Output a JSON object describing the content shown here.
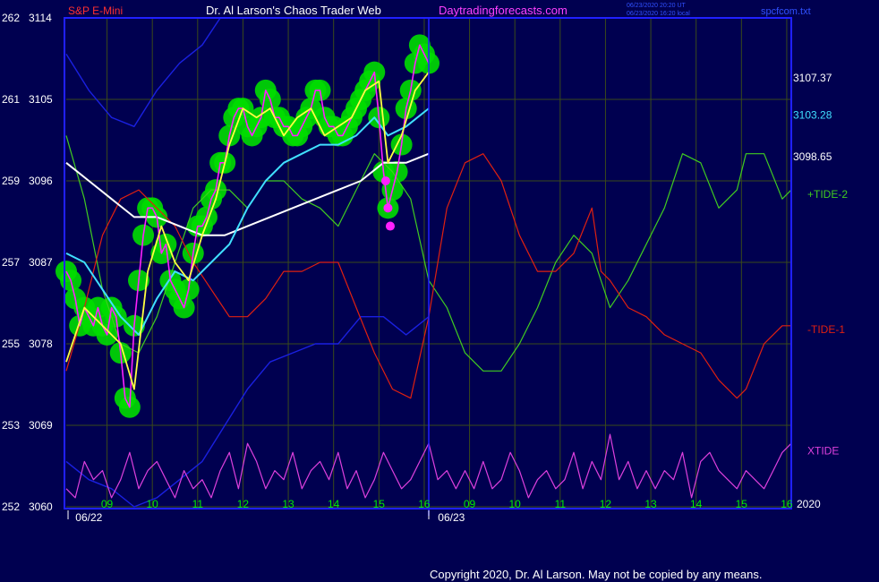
{
  "header": {
    "instrument": "S&P E-Mini",
    "title": "Dr. Al Larson's Chaos Trader Web",
    "site": "Daytradingforecasts.com",
    "time_line1": "06/23/2020 20:20 UT",
    "time_line2": "06/23/2020 16:20 local",
    "file": "spcfcom.txt"
  },
  "footer": {
    "copyright": "Copyright 2020, Dr. Al Larson. May not be copied by any means.",
    "year": "2020"
  },
  "colors": {
    "background": "#000050",
    "frame": "#2020ff",
    "grid": "#3a4a1a",
    "price": "#ff20ff",
    "glow": "#00dd00",
    "ema_fast": "#ffff40",
    "ema_mid": "#40e0ff",
    "ema_slow": "#ffffff",
    "band": "#1a20e0",
    "tide2": "#40cc20",
    "tide1": "#e02010",
    "xtide": "#dd40dd",
    "instrument_text": "#ff3030",
    "title_text": "#ffffff",
    "site_text": "#ff40ff",
    "axis_text": "#ffffff",
    "hour_text": "#00ee00"
  },
  "chart_data": {
    "type": "line",
    "title": "S&P E-Mini",
    "ylim": [
      3060,
      3114
    ],
    "y_ticks": [
      {
        "left": "262",
        "price": "3114",
        "value": 3114
      },
      {
        "left": "261",
        "price": "3105",
        "value": 3105
      },
      {
        "left": "259",
        "price": "3096",
        "value": 3096
      },
      {
        "left": "257",
        "price": "3087",
        "value": 3087
      },
      {
        "left": "255",
        "price": "3078",
        "value": 3078
      },
      {
        "left": "253",
        "price": "3069",
        "value": 3069
      },
      {
        "left": "252",
        "price": "3060",
        "value": 3060
      }
    ],
    "x_ticks": [
      {
        "label": "09",
        "idx": 0.9
      },
      {
        "label": "10",
        "idx": 1.9
      },
      {
        "label": "11",
        "idx": 2.9
      },
      {
        "label": "12",
        "idx": 3.9
      },
      {
        "label": "13",
        "idx": 4.9
      },
      {
        "label": "14",
        "idx": 5.9
      },
      {
        "label": "15",
        "idx": 6.9
      },
      {
        "label": "16",
        "idx": 7.9
      },
      {
        "label": "09",
        "idx": 8.9
      },
      {
        "label": "10",
        "idx": 9.9
      },
      {
        "label": "11",
        "idx": 10.9
      },
      {
        "label": "12",
        "idx": 11.9
      },
      {
        "label": "13",
        "idx": 12.9
      },
      {
        "label": "14",
        "idx": 13.9
      },
      {
        "label": "15",
        "idx": 14.9
      },
      {
        "label": "16",
        "idx": 15.9
      }
    ],
    "x_max": 16,
    "date_labels": [
      {
        "label": "06/22",
        "idx": 0.5
      },
      {
        "label": "06/23",
        "idx": 8.5
      }
    ],
    "now_idx": 8.0,
    "right_labels": [
      {
        "label": "3107.37",
        "value": 3107.37,
        "color": "#ffffff"
      },
      {
        "label": "3103.28",
        "value": 3103.28,
        "color": "#40e0ff"
      },
      {
        "label": "3098.65",
        "value": 3098.65,
        "color": "#ffffff"
      }
    ],
    "tide_labels": [
      {
        "label": "+TIDE-2",
        "value": 3094.5,
        "color": "#40cc20"
      },
      {
        "label": "-TIDE-1",
        "value": 3079.6,
        "color": "#e02010"
      },
      {
        "label": "XTIDE",
        "value": 3066.2,
        "color": "#dd40dd"
      }
    ],
    "series": [
      {
        "key": "price",
        "x": [
          0,
          0.1,
          0.2,
          0.3,
          0.4,
          0.5,
          0.6,
          0.7,
          0.8,
          0.9,
          1.0,
          1.1,
          1.2,
          1.3,
          1.4,
          1.5,
          1.6,
          1.7,
          1.8,
          1.9,
          2.0,
          2.1,
          2.2,
          2.3,
          2.4,
          2.5,
          2.6,
          2.7,
          2.8,
          2.9,
          3.0,
          3.1,
          3.2,
          3.3,
          3.4,
          3.5,
          3.6,
          3.7,
          3.8,
          3.9,
          4.0,
          4.1,
          4.2,
          4.3,
          4.4,
          4.5,
          4.6,
          4.7,
          4.8,
          4.9,
          5.0,
          5.1,
          5.2,
          5.3,
          5.4,
          5.5,
          5.6,
          5.7,
          5.8,
          5.9,
          6.0,
          6.1,
          6.2,
          6.3,
          6.4,
          6.5,
          6.6,
          6.7,
          6.8,
          6.9,
          7.0,
          7.1,
          7.2,
          7.3,
          7.4,
          7.5,
          7.6,
          7.7,
          7.8,
          7.9,
          8.0
        ],
        "y": [
          3086,
          3085,
          3083,
          3080,
          3082,
          3081,
          3080,
          3082,
          3080,
          3079,
          3082,
          3081,
          3077,
          3072,
          3071,
          3080,
          3085,
          3090,
          3093,
          3093,
          3092,
          3088,
          3089,
          3085,
          3084,
          3083,
          3082,
          3084,
          3088,
          3091,
          3091,
          3092,
          3094,
          3095,
          3098,
          3098,
          3101,
          3103,
          3104,
          3104,
          3102,
          3101,
          3102,
          3103,
          3106,
          3105,
          3103,
          3103,
          3102,
          3102,
          3101,
          3101,
          3102,
          3103,
          3104,
          3106,
          3106,
          3103,
          3102,
          3102,
          3101,
          3101,
          3102,
          3103,
          3104,
          3105,
          3106,
          3107,
          3108,
          3103,
          3097,
          3093,
          3095,
          3097,
          3100,
          3104,
          3106,
          3109,
          3111,
          3110,
          3109
        ]
      },
      {
        "key": "ema_fast",
        "x": [
          0,
          0.4,
          0.8,
          1.2,
          1.5,
          1.8,
          2.1,
          2.4,
          2.7,
          3.0,
          3.3,
          3.6,
          3.9,
          4.2,
          4.5,
          4.8,
          5.1,
          5.4,
          5.7,
          6.0,
          6.3,
          6.6,
          6.9,
          7.1,
          7.4,
          7.7,
          8.0
        ],
        "y": [
          3076,
          3082,
          3080,
          3078,
          3073,
          3086,
          3091,
          3087,
          3085,
          3090,
          3094,
          3100,
          3104,
          3103,
          3104,
          3101,
          3103,
          3104,
          3101,
          3102,
          3103,
          3106,
          3107,
          3098,
          3101,
          3106,
          3108
        ]
      },
      {
        "key": "ema_mid",
        "x": [
          0,
          0.4,
          0.8,
          1.2,
          1.6,
          2.0,
          2.4,
          2.8,
          3.2,
          3.6,
          4.0,
          4.4,
          4.8,
          5.2,
          5.6,
          6.0,
          6.4,
          6.8,
          7.1,
          7.5,
          8.0
        ],
        "y": [
          3088,
          3087,
          3084,
          3081,
          3079,
          3083,
          3086,
          3085,
          3087,
          3089,
          3093,
          3096,
          3098,
          3099,
          3100,
          3100,
          3101,
          3103,
          3101,
          3102,
          3104
        ]
      },
      {
        "key": "ema_slow",
        "x": [
          0,
          0.5,
          1.0,
          1.5,
          2.0,
          2.5,
          3.0,
          3.5,
          4.0,
          4.5,
          5.0,
          5.5,
          6.0,
          6.5,
          7.0,
          7.5,
          8.0
        ],
        "y": [
          3098,
          3096,
          3094,
          3092,
          3092,
          3091,
          3090,
          3090,
          3091,
          3092,
          3093,
          3094,
          3095,
          3096,
          3098,
          3098,
          3099
        ]
      },
      {
        "key": "band_upper",
        "x": [
          0,
          0.5,
          1.0,
          1.5,
          2.0,
          2.5,
          3.0,
          3.4
        ],
        "y": [
          3110,
          3106,
          3103,
          3102,
          3106,
          3109,
          3111,
          3114
        ]
      },
      {
        "key": "band_lower",
        "x": [
          0,
          0.5,
          1.0,
          1.5,
          2.0,
          2.5,
          3.0,
          3.5,
          4.0,
          4.5,
          5.0,
          5.5,
          6.0,
          6.5,
          7.0,
          7.5,
          8.0
        ],
        "y": [
          3065,
          3063,
          3062,
          3060,
          3061,
          3063,
          3065,
          3069,
          3073,
          3076,
          3077,
          3078,
          3078,
          3081,
          3081,
          3079,
          3081
        ]
      },
      {
        "key": "tide2",
        "x": [
          0,
          0.4,
          0.8,
          1.2,
          1.6,
          2.0,
          2.4,
          2.8,
          3.2,
          3.6,
          4.0,
          4.4,
          4.8,
          5.2,
          5.6,
          6.0,
          6.4,
          6.8,
          7.2,
          7.6,
          8.0,
          8.4,
          8.8,
          9.2,
          9.6,
          10.0,
          10.4,
          10.8,
          11.2,
          11.6,
          11.8,
          12.0,
          12.4,
          12.8,
          13.2,
          13.6,
          14.0,
          14.4,
          14.8,
          15.0,
          15.4,
          15.8,
          16.0
        ],
        "y": [
          3101,
          3094,
          3084,
          3078,
          3077,
          3081,
          3087,
          3093,
          3095,
          3095,
          3093,
          3096,
          3096,
          3094,
          3093,
          3091,
          3095,
          3099,
          3097,
          3094,
          3085,
          3082,
          3077,
          3075,
          3075,
          3078,
          3082,
          3087,
          3090,
          3088,
          3085,
          3082,
          3085,
          3089,
          3093,
          3099,
          3098,
          3093,
          3095,
          3099,
          3099,
          3094,
          3095
        ]
      },
      {
        "key": "tide1",
        "x": [
          0,
          0.4,
          0.8,
          1.2,
          1.6,
          2.0,
          2.4,
          2.8,
          3.2,
          3.6,
          4.0,
          4.4,
          4.8,
          5.2,
          5.6,
          6.0,
          6.4,
          6.8,
          7.2,
          7.6,
          8.0,
          8.4,
          8.8,
          9.2,
          9.6,
          10.0,
          10.4,
          10.8,
          11.2,
          11.6,
          11.8,
          12.0,
          12.4,
          12.8,
          13.2,
          13.6,
          14.0,
          14.4,
          14.8,
          15.0,
          15.4,
          15.8,
          16.0
        ],
        "y": [
          3075,
          3082,
          3090,
          3094,
          3095,
          3093,
          3091,
          3087,
          3084,
          3081,
          3081,
          3083,
          3086,
          3086,
          3087,
          3087,
          3082,
          3077,
          3073,
          3072,
          3081,
          3093,
          3098,
          3099,
          3096,
          3090,
          3086,
          3086,
          3088,
          3093,
          3086,
          3085,
          3082,
          3081,
          3079,
          3078,
          3077,
          3074,
          3072,
          3073,
          3078,
          3080,
          3080
        ]
      },
      {
        "key": "xtide",
        "x": [
          0,
          0.2,
          0.4,
          0.6,
          0.8,
          1.0,
          1.2,
          1.4,
          1.6,
          1.8,
          2.0,
          2.2,
          2.4,
          2.6,
          2.8,
          3.0,
          3.2,
          3.4,
          3.6,
          3.8,
          4.0,
          4.2,
          4.4,
          4.6,
          4.8,
          5.0,
          5.2,
          5.4,
          5.6,
          5.8,
          6.0,
          6.2,
          6.4,
          6.6,
          6.8,
          7.0,
          7.2,
          7.4,
          7.6,
          7.8,
          8.0,
          8.2,
          8.4,
          8.6,
          8.8,
          9.0,
          9.2,
          9.4,
          9.6,
          9.8,
          10.0,
          10.2,
          10.4,
          10.6,
          10.8,
          11.0,
          11.2,
          11.4,
          11.6,
          11.8,
          12.0,
          12.2,
          12.4,
          12.6,
          12.8,
          13.0,
          13.2,
          13.4,
          13.6,
          13.8,
          14.0,
          14.2,
          14.4,
          14.6,
          14.8,
          15.0,
          15.2,
          15.4,
          15.6,
          15.8,
          16.0
        ],
        "y": [
          3062,
          3061,
          3065,
          3063,
          3064,
          3061,
          3063,
          3066,
          3062,
          3064,
          3065,
          3063,
          3061,
          3064,
          3062,
          3063,
          3061,
          3064,
          3066,
          3062,
          3067,
          3065,
          3062,
          3064,
          3063,
          3066,
          3062,
          3064,
          3065,
          3063,
          3066,
          3062,
          3064,
          3061,
          3063,
          3066,
          3064,
          3062,
          3063,
          3065,
          3067,
          3063,
          3064,
          3062,
          3064,
          3062,
          3065,
          3062,
          3063,
          3066,
          3064,
          3061,
          3063,
          3064,
          3062,
          3063,
          3066,
          3062,
          3065,
          3063,
          3068,
          3063,
          3065,
          3062,
          3064,
          3062,
          3064,
          3063,
          3066,
          3061,
          3065,
          3066,
          3064,
          3063,
          3062,
          3064,
          3063,
          3062,
          3064,
          3066,
          3067
        ]
      }
    ],
    "dots": [
      {
        "x": 7.05,
        "y": 3096
      },
      {
        "x": 7.1,
        "y": 3093
      },
      {
        "x": 7.15,
        "y": 3091
      }
    ]
  }
}
